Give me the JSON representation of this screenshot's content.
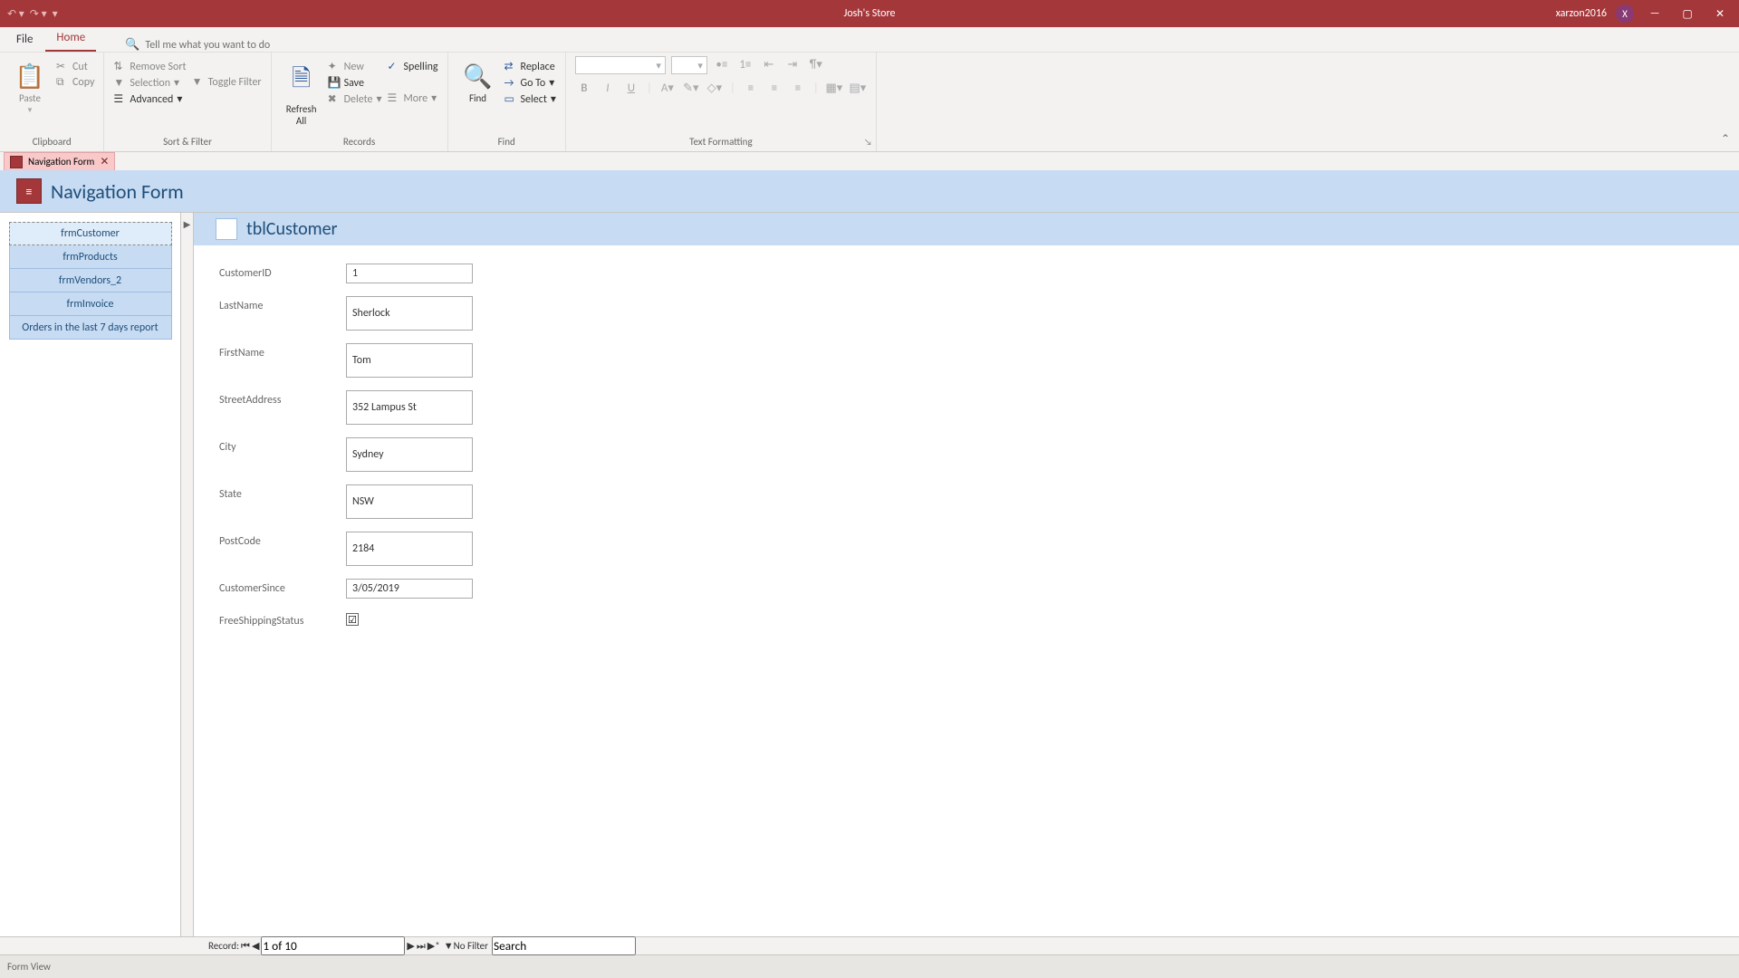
{
  "titlebar": {
    "app_title": "Josh's Store",
    "user": "xarzon2016",
    "avatar": "X"
  },
  "menutabs": {
    "file": "File",
    "home": "Home",
    "tellme": "Tell me what you want to do"
  },
  "ribbon": {
    "clipboard": {
      "label": "Clipboard",
      "paste": "Paste",
      "cut": "Cut",
      "copy": "Copy"
    },
    "sortfilter": {
      "label": "Sort & Filter",
      "remove_sort": "Remove Sort",
      "selection": "Selection",
      "toggle_filter": "Toggle Filter",
      "advanced": "Advanced"
    },
    "records": {
      "label": "Records",
      "refresh_all": "Refresh\nAll",
      "new": "New",
      "save": "Save",
      "delete": "Delete",
      "spelling": "Spelling",
      "more": "More"
    },
    "find": {
      "label": "Find",
      "find": "Find",
      "replace": "Replace",
      "goto": "Go To",
      "select": "Select"
    },
    "textfmt": {
      "label": "Text Formatting"
    }
  },
  "doctab": {
    "name": "Navigation Form"
  },
  "navform": {
    "title": "Navigation Form",
    "items": [
      "frmCustomer",
      "frmProducts",
      "frmVendors_2",
      "frmInvoice",
      "Orders in the last 7 days report"
    ]
  },
  "subform": {
    "title": "tblCustomer",
    "fields": {
      "customerid": {
        "label": "CustomerID",
        "value": "1"
      },
      "lastname": {
        "label": "LastName",
        "value": "Sherlock"
      },
      "firstname": {
        "label": "FirstName",
        "value": "Tom"
      },
      "streetaddress": {
        "label": "StreetAddress",
        "value": "352 Lampus St"
      },
      "city": {
        "label": "City",
        "value": "Sydney"
      },
      "state": {
        "label": "State",
        "value": "NSW"
      },
      "postcode": {
        "label": "PostCode",
        "value": "2184"
      },
      "customersince": {
        "label": "CustomerSince",
        "value": "3/05/2019"
      },
      "freeshipping": {
        "label": "FreeShippingStatus",
        "checked": "☑"
      }
    }
  },
  "recnav": {
    "label": "Record:",
    "pos": "1 of 10",
    "nofilter": "No Filter",
    "search": "Search"
  },
  "statusbar": {
    "mode": "Form View"
  }
}
